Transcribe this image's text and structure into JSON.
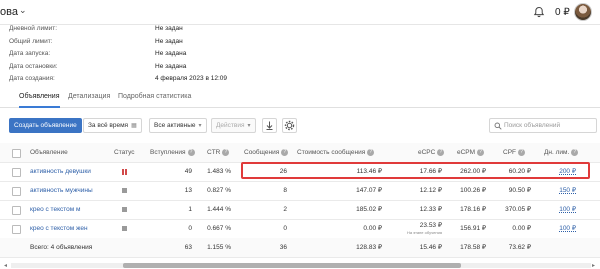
{
  "header": {
    "breadcrumb": "ова",
    "balance": "0 ₽"
  },
  "info": [
    {
      "label": "Дневной лимит:",
      "value": "Не задан"
    },
    {
      "label": "Общий лимит:",
      "value": "Не задан"
    },
    {
      "label": "Дата запуска:",
      "value": "Не задана"
    },
    {
      "label": "Дата остановки:",
      "value": "Не задана"
    },
    {
      "label": "Дата создания:",
      "value": "4 февраля 2023 в 12:09"
    }
  ],
  "tabs": [
    "Объявления",
    "Детализация",
    "Подробная статистика"
  ],
  "toolbar": {
    "create": "Создать объявление",
    "period": "За всё время",
    "filter": "Все активные",
    "actions": "Действия",
    "search_placeholder": "Поиск объявлений"
  },
  "table": {
    "columns": [
      "Объявление",
      "Статус",
      "Вступления",
      "CTR",
      "Сообщения",
      "Стоимость сообщения",
      "eCPC",
      "eCPM",
      "CPF",
      "Дн. лим."
    ],
    "rows": [
      {
        "name": "активность девушки",
        "status": "paused",
        "joins": "49",
        "ctr": "1.483 %",
        "messages": "26",
        "msg_cost": "113.46 ₽",
        "ecpc": "17.66 ₽",
        "ecpm": "262.00 ₽",
        "cpf": "60.20 ₽",
        "limit": "200 ₽"
      },
      {
        "name": "активность мужчины",
        "status": "stopped",
        "joins": "13",
        "ctr": "0.827 %",
        "messages": "8",
        "msg_cost": "147.07 ₽",
        "ecpc": "12.12 ₽",
        "ecpm": "100.26 ₽",
        "cpf": "90.50 ₽",
        "limit": "150 ₽"
      },
      {
        "name": "крео с текстом м",
        "status": "stopped",
        "joins": "1",
        "ctr": "1.444 %",
        "messages": "2",
        "msg_cost": "185.02 ₽",
        "ecpc": "12.33 ₽",
        "ecpm": "178.16 ₽",
        "cpf": "370.05 ₽",
        "limit": "100 ₽"
      },
      {
        "name": "крео с текстом жен",
        "status": "stopped",
        "joins": "0",
        "ctr": "0.667 %",
        "messages": "0",
        "msg_cost": "0.00 ₽",
        "ecpc": "23.53 ₽",
        "ecpc_note": "На этапе обучения",
        "ecpm": "156.91 ₽",
        "cpf": "0.00 ₽",
        "limit": "100 ₽"
      }
    ],
    "total": {
      "label": "Всего: 4 объявления",
      "joins": "63",
      "ctr": "1.155 %",
      "messages": "36",
      "msg_cost": "128.83 ₽",
      "ecpc": "15.46 ₽",
      "ecpm": "178.58 ₽",
      "cpf": "73.62 ₽"
    }
  }
}
